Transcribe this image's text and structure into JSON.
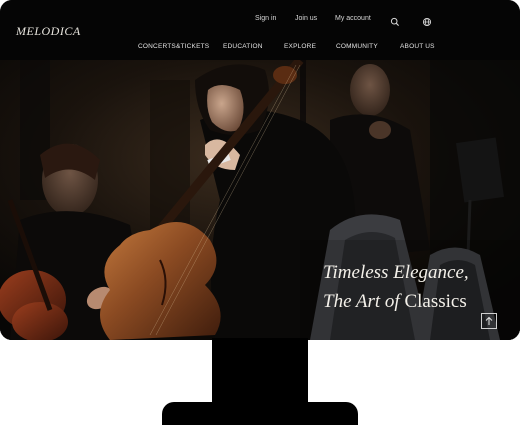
{
  "brand": {
    "logo_text": "MELODICA"
  },
  "utility_nav": {
    "sign_in": "Sign in",
    "join_us": "Join us",
    "my_account": "My account",
    "search_icon": "search-icon",
    "language_icon": "globe-icon"
  },
  "main_nav": {
    "items": [
      {
        "label": "CONCERTS&TICKETS"
      },
      {
        "label": "EDUCATION"
      },
      {
        "label": "EXPLORE"
      },
      {
        "label": "COMMUNITY"
      },
      {
        "label": "ABOUT US"
      }
    ]
  },
  "hero": {
    "headline_line1": "Timeless Elegance,",
    "headline_line2_prefix": "The Art of",
    "headline_line2_emphasis": "Classics",
    "scroll_button_icon": "arrow-up-icon"
  },
  "colors": {
    "screen_background": "#050505",
    "text_primary": "#f4f1ea",
    "cello_wood": "#8a4a22"
  }
}
